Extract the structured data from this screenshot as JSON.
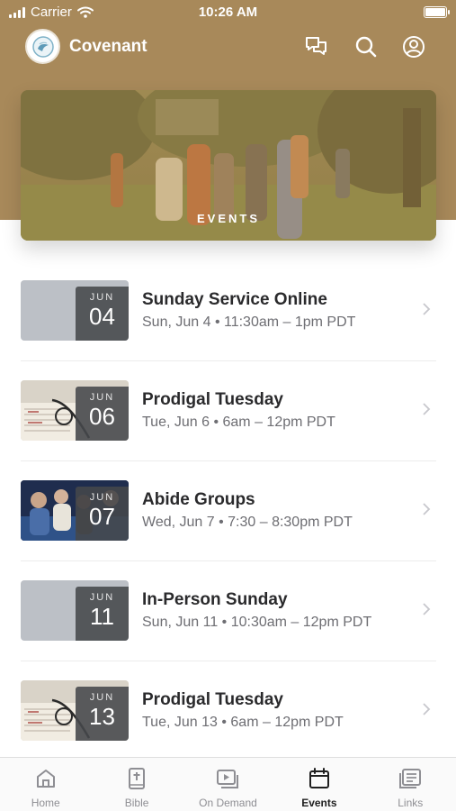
{
  "status_bar": {
    "carrier": "Carrier",
    "time": "10:26 AM"
  },
  "header": {
    "title": "Covenant",
    "chat_icon": "chat-bubbles-icon",
    "search_icon": "search-icon",
    "profile_icon": "user-circle-icon"
  },
  "banner": {
    "label": "EVENTS"
  },
  "events": [
    {
      "month": "JUN",
      "day": "04",
      "title": "Sunday Service Online",
      "subtitle": "Sun, Jun 4 • 11:30am – 1pm PDT",
      "thumb": "blank"
    },
    {
      "month": "JUN",
      "day": "06",
      "title": "Prodigal Tuesday",
      "subtitle": "Tue, Jun 6 • 6am – 12pm PDT",
      "thumb": "glasses-bible"
    },
    {
      "month": "JUN",
      "day": "07",
      "title": "Abide Groups",
      "subtitle": "Wed, Jun 7 • 7:30 – 8:30pm PDT",
      "thumb": "group-photo"
    },
    {
      "month": "JUN",
      "day": "11",
      "title": "In-Person Sunday",
      "subtitle": "Sun, Jun 11 • 10:30am – 12pm PDT",
      "thumb": "blank"
    },
    {
      "month": "JUN",
      "day": "13",
      "title": "Prodigal Tuesday",
      "subtitle": "Tue, Jun 13 • 6am – 12pm PDT",
      "thumb": "glasses-bible"
    }
  ],
  "tab_bar": [
    {
      "label": "Home",
      "icon": "home-icon"
    },
    {
      "label": "Bible",
      "icon": "bible-icon"
    },
    {
      "label": "On Demand",
      "icon": "video-icon"
    },
    {
      "label": "Events",
      "icon": "calendar-icon",
      "active": true
    },
    {
      "label": "Links",
      "icon": "links-icon"
    }
  ],
  "colors": {
    "brand": "#a8895a",
    "badge": "#58595b",
    "text": "#2a2a2c",
    "subtext": "#6e6e73"
  }
}
